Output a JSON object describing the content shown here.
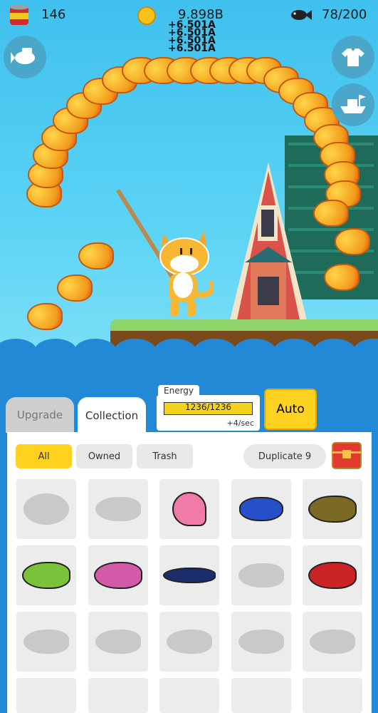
{
  "hud": {
    "cans_count": "146",
    "coins_value": "9.898B",
    "coin_popups": [
      "+6.501A",
      "+6.501A",
      "+6.501A",
      "+6.501A"
    ],
    "fish_capacity": "78/200"
  },
  "icons": {
    "can": "can-icon",
    "coin": "coin-icon",
    "fish": "fish-icon",
    "fish_shop": "fish-shop-icon",
    "shirt": "shirt-icon",
    "boat": "boat-icon",
    "chest": "treasure-chest-icon"
  },
  "tabs": [
    {
      "label": "Upgrade",
      "active": false
    },
    {
      "label": "Collection",
      "active": true
    }
  ],
  "energy": {
    "title": "Energy",
    "value": "1236/1236",
    "rate": "+4/sec",
    "fill": 1.0
  },
  "auto_label": "Auto",
  "filters": [
    {
      "label": "All",
      "active": true
    },
    {
      "label": "Owned",
      "active": false
    },
    {
      "label": "Trash",
      "active": false
    }
  ],
  "duplicate_label": "Duplicate 9",
  "collection": [
    {
      "name": "turtle",
      "owned": false
    },
    {
      "name": "dark-fish",
      "owned": false
    },
    {
      "name": "conch-shell",
      "owned": true,
      "color": "#f07ba8"
    },
    {
      "name": "blue-crab",
      "owned": true,
      "color": "#2550c8"
    },
    {
      "name": "brown-spotted-fish",
      "owned": true,
      "color": "#7a6a23"
    },
    {
      "name": "green-tetra",
      "owned": true,
      "color": "#79c23a"
    },
    {
      "name": "pink-fish",
      "owned": true,
      "color": "#d35aa8"
    },
    {
      "name": "marlin",
      "owned": true,
      "color": "#1b2d6b"
    },
    {
      "name": "grey-fish",
      "owned": false
    },
    {
      "name": "red-grouper",
      "owned": true,
      "color": "#c92323"
    },
    {
      "name": "fish-a",
      "owned": false
    },
    {
      "name": "fish-b",
      "owned": false
    },
    {
      "name": "fish-c",
      "owned": false
    },
    {
      "name": "fish-d",
      "owned": false
    },
    {
      "name": "fish-e",
      "owned": false
    }
  ],
  "colors": {
    "sky": "#3fc0ee",
    "sea": "#2289d6",
    "accent_yellow": "#ffd21f",
    "fish_orange": "#f29a1a"
  }
}
